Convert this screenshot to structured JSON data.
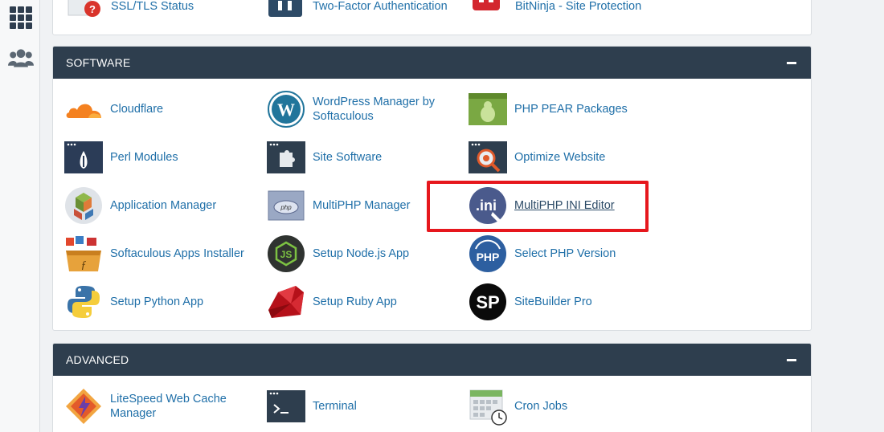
{
  "rail": {
    "items": [
      {
        "icon": "apps-grid-icon"
      },
      {
        "icon": "users-icon"
      }
    ]
  },
  "top_panel": {
    "items": [
      {
        "label": "SSL/TLS Status",
        "icon": "ssl-status-icon"
      },
      {
        "label": "Two-Factor Authentication",
        "icon": "two-factor-icon"
      },
      {
        "label": "BitNinja - Site Protection",
        "icon": "bitninja-icon"
      }
    ]
  },
  "software": {
    "title": "SOFTWARE",
    "items": [
      {
        "label": "Cloudflare",
        "icon": "cloudflare-icon"
      },
      {
        "label": "WordPress Manager by Softaculous",
        "icon": "wordpress-icon"
      },
      {
        "label": "PHP PEAR Packages",
        "icon": "php-pear-icon"
      },
      {
        "label": "Perl Modules",
        "icon": "perl-icon"
      },
      {
        "label": "Site Software",
        "icon": "puzzle-icon"
      },
      {
        "label": "Optimize Website",
        "icon": "optimize-icon"
      },
      {
        "label": "Application Manager",
        "icon": "app-manager-icon"
      },
      {
        "label": "MultiPHP Manager",
        "icon": "php-manager-icon"
      },
      {
        "label": "MultiPHP INI Editor",
        "icon": "ini-editor-icon"
      },
      {
        "label": "Softaculous Apps Installer",
        "icon": "softaculous-icon"
      },
      {
        "label": "Setup Node.js App",
        "icon": "nodejs-icon"
      },
      {
        "label": "Select PHP Version",
        "icon": "php-version-icon"
      },
      {
        "label": "Setup Python App",
        "icon": "python-icon"
      },
      {
        "label": "Setup Ruby App",
        "icon": "ruby-icon"
      },
      {
        "label": "SiteBuilder Pro",
        "icon": "sitebuilder-icon"
      }
    ]
  },
  "advanced": {
    "title": "ADVANCED",
    "items": [
      {
        "label": "LiteSpeed Web Cache Manager",
        "icon": "litespeed-icon"
      },
      {
        "label": "Terminal",
        "icon": "terminal-icon"
      },
      {
        "label": "Cron Jobs",
        "icon": "cron-icon"
      }
    ]
  },
  "colors": {
    "header_bg": "#2e3e4e",
    "link": "#1f6fa8",
    "highlight": "#e6171d"
  }
}
